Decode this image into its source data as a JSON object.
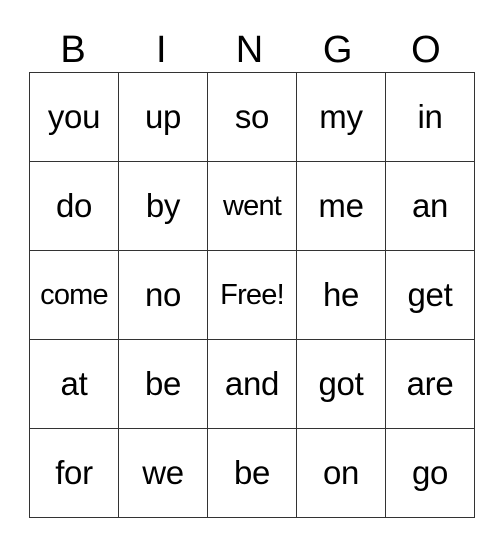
{
  "header": [
    "B",
    "I",
    "N",
    "G",
    "O"
  ],
  "rows": [
    [
      "you",
      "up",
      "so",
      "my",
      "in"
    ],
    [
      "do",
      "by",
      "went",
      "me",
      "an"
    ],
    [
      "come",
      "no",
      "Free!",
      "he",
      "get"
    ],
    [
      "at",
      "be",
      "and",
      "got",
      "are"
    ],
    [
      "for",
      "we",
      "be",
      "on",
      "go"
    ]
  ]
}
